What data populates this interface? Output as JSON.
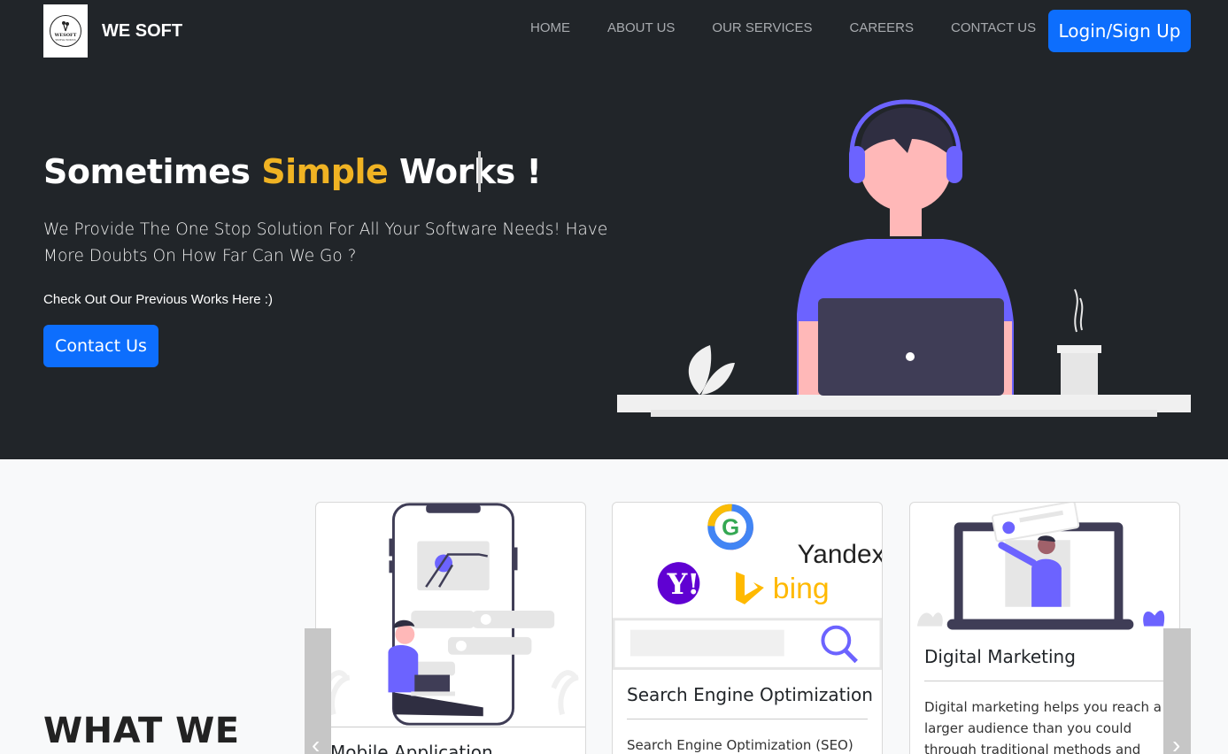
{
  "brand": {
    "name": "WE SOFT",
    "logo_text": "WESOFT",
    "logo_subtext": "SIMPLE WORKS"
  },
  "nav": {
    "items": [
      "HOME",
      "ABOUT US",
      "OUR SERVICES",
      "CAREERS",
      "CONTACT US"
    ],
    "login_label": "Login/Sign Up"
  },
  "hero": {
    "title_pre": "Sometimes ",
    "title_highlight": "Simple",
    "title_post": " Works !",
    "description": "We Provide The One Stop Solution For All Your Software Needs! Have More Doubts On How Far Can We Go ?",
    "check": "Check Out Our Previous Works Here :)",
    "contact_label": "Contact Us"
  },
  "section": {
    "heading": "WHAT WE"
  },
  "cards": [
    {
      "title": "Mobile Application",
      "text": ""
    },
    {
      "title": "Search Engine Optimization",
      "text": "Search Engine Optimization (SEO)"
    },
    {
      "title": "Digital Marketing",
      "text": "Digital marketing helps you reach a larger audience than you could through traditional methods and"
    }
  ],
  "seo_logos": {
    "google": "G",
    "yandex": "Yandex",
    "yahoo": "Y!",
    "bing": "bing"
  },
  "carousel": {
    "prev_icon": "‹",
    "next_icon": "›"
  },
  "colors": {
    "dark": "#212529",
    "accent": "#f0b323",
    "primary": "#0d6efd",
    "purple": "#6c63ff"
  }
}
